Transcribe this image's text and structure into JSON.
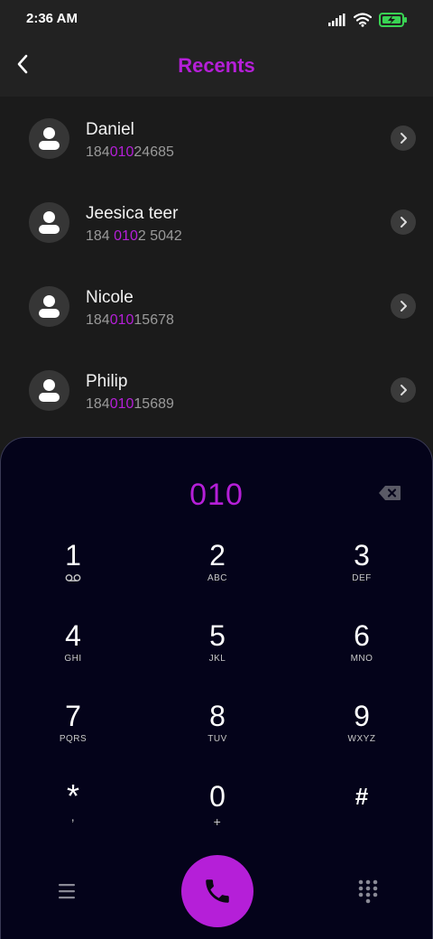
{
  "status": {
    "time": "2:36 AM"
  },
  "header": {
    "title": "Recents"
  },
  "contacts": [
    {
      "name": "Daniel",
      "number": {
        "before": "184",
        "match": "010",
        "after": "24685"
      }
    },
    {
      "name": "Jeesica teer",
      "number": {
        "before": "184 ",
        "match": "010",
        "after": "2 5042"
      }
    },
    {
      "name": "Nicole",
      "number": {
        "before": "184",
        "match": "010",
        "after": "15678"
      }
    },
    {
      "name": "Philip",
      "number": {
        "before": "184",
        "match": "010",
        "after": "15689"
      }
    }
  ],
  "dialpad": {
    "input": "010",
    "keys": [
      {
        "digit": "1",
        "letters": ""
      },
      {
        "digit": "2",
        "letters": "ABC"
      },
      {
        "digit": "3",
        "letters": "DEF"
      },
      {
        "digit": "4",
        "letters": "GHI"
      },
      {
        "digit": "5",
        "letters": "JKL"
      },
      {
        "digit": "6",
        "letters": "MNO"
      },
      {
        "digit": "7",
        "letters": "PQRS"
      },
      {
        "digit": "8",
        "letters": "TUV"
      },
      {
        "digit": "9",
        "letters": "WXYZ"
      },
      {
        "digit": "*",
        "letters": ","
      },
      {
        "digit": "0",
        "letters": "+"
      },
      {
        "digit": "#",
        "letters": ""
      }
    ]
  },
  "colors": {
    "accent": "#b51fd8",
    "dialpad_bg": "#04031a",
    "list_bg": "#1b1b1b",
    "battery": "#39d353"
  },
  "icons": {
    "back": "chevron-left-icon",
    "contact": "person-icon",
    "detail": "chevron-right-icon",
    "backspace": "backspace-icon",
    "voicemail": "voicemail-icon",
    "menu": "menu-icon",
    "call": "phone-icon",
    "keypad": "dialpad-icon"
  }
}
